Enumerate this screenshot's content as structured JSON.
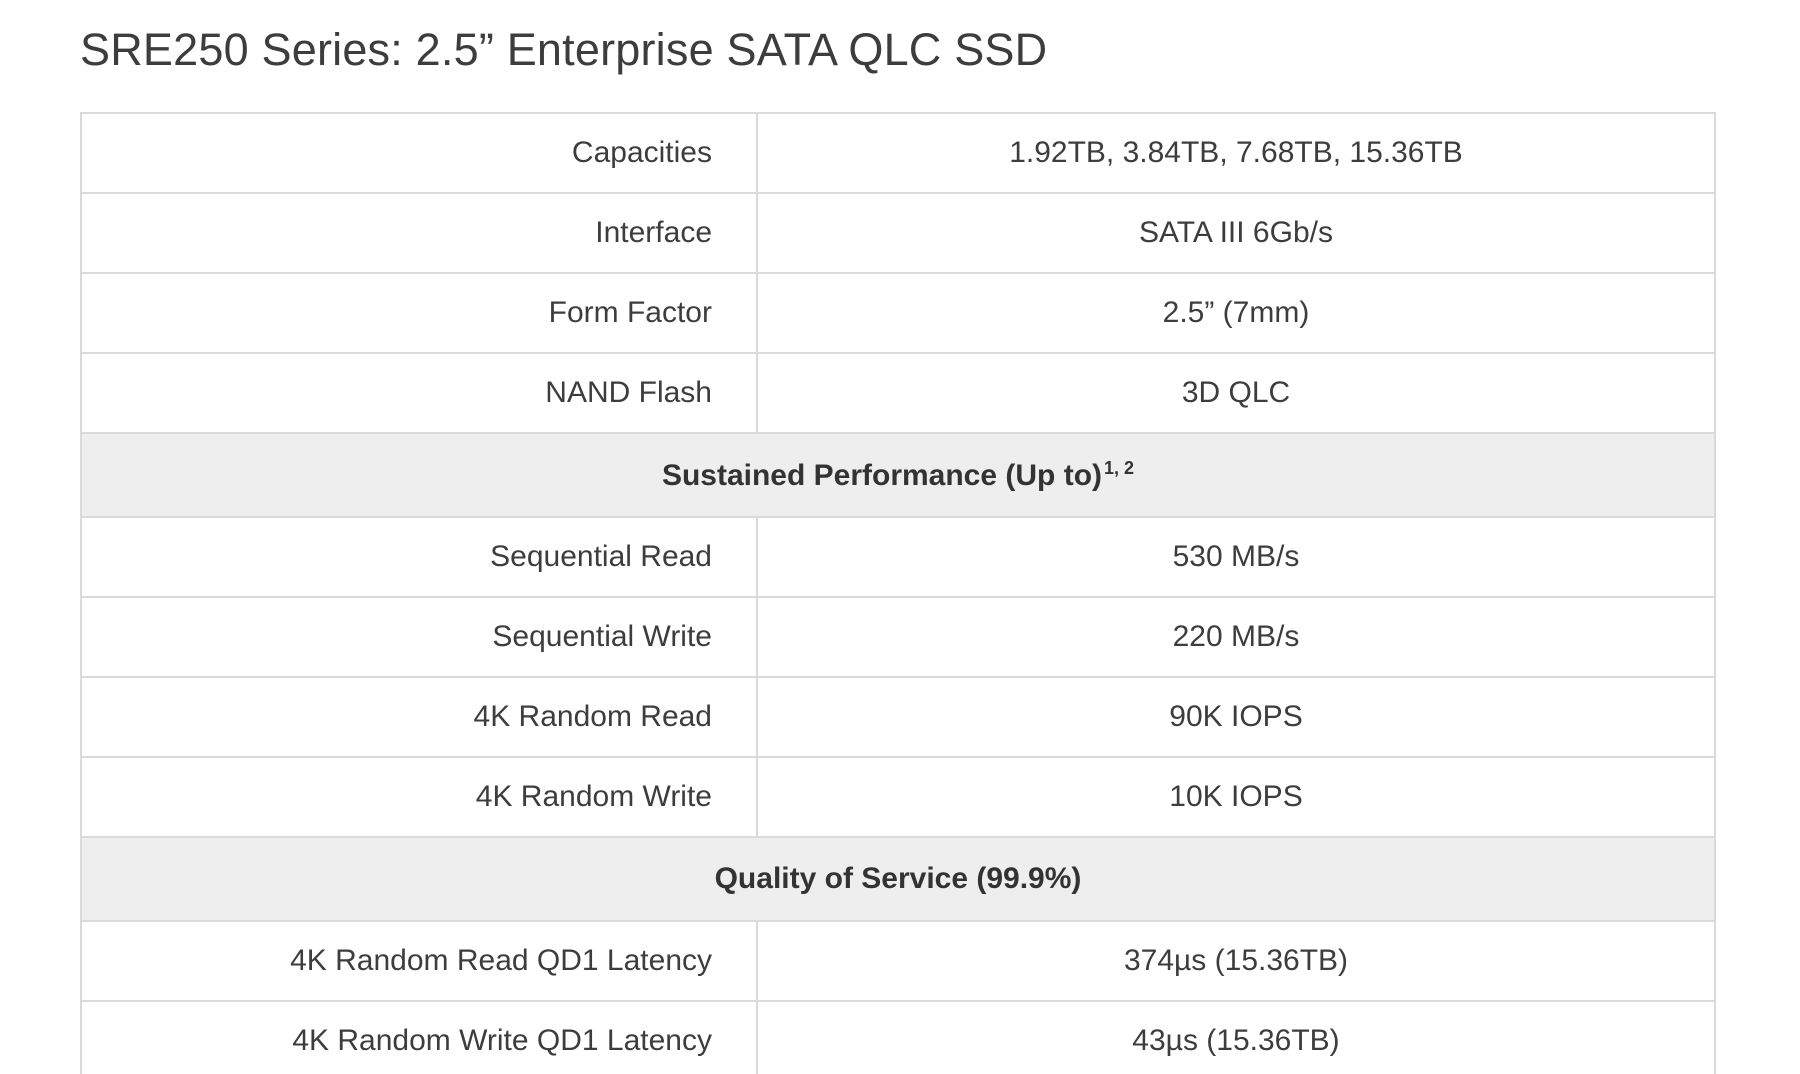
{
  "title": "SRE250 Series: 2.5” Enterprise SATA QLC SSD",
  "rows": [
    {
      "type": "data",
      "label": "Capacities",
      "value": "1.92TB, 3.84TB, 7.68TB, 15.36TB"
    },
    {
      "type": "data",
      "label": "Interface",
      "value": "SATA III 6Gb/s"
    },
    {
      "type": "data",
      "label": "Form Factor",
      "value": "2.5” (7mm)"
    },
    {
      "type": "data",
      "label": "NAND Flash",
      "value": "3D QLC"
    },
    {
      "type": "section",
      "label": "Sustained Performance (Up to)",
      "sup": "1, 2"
    },
    {
      "type": "data",
      "label": "Sequential Read",
      "value": "530 MB/s"
    },
    {
      "type": "data",
      "label": "Sequential Write",
      "value": "220 MB/s"
    },
    {
      "type": "data",
      "label": "4K Random Read",
      "value": "90K IOPS"
    },
    {
      "type": "data",
      "label": "4K Random Write",
      "value": "10K IOPS"
    },
    {
      "type": "section",
      "label": "Quality of Service (99.9%)"
    },
    {
      "type": "data",
      "label": "4K Random Read QD1 Latency",
      "value": "374µs (15.36TB)"
    },
    {
      "type": "data",
      "label": "4K Random Write QD1 Latency",
      "value": "43µs (15.36TB)"
    }
  ]
}
